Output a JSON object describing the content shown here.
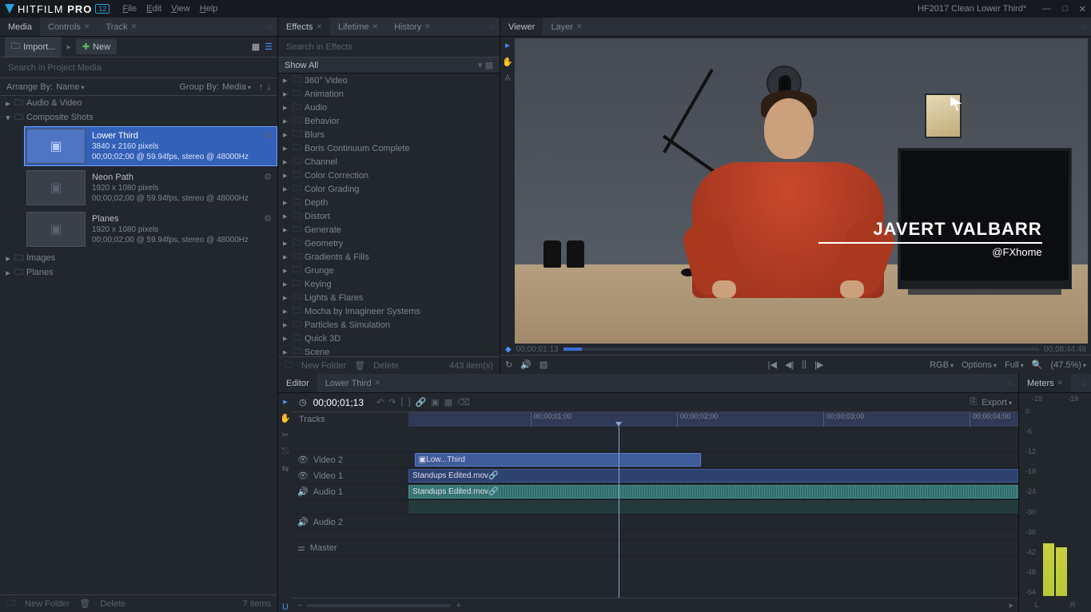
{
  "titlebar": {
    "app_name_light": "HITFILM",
    "app_name_bold": "PRO",
    "version": "12",
    "menu": [
      "File",
      "Edit",
      "View",
      "Help"
    ],
    "project_name": "HF2017 Clean Lower Third*"
  },
  "media_panel": {
    "tabs": [
      {
        "label": "Media",
        "active": true
      },
      {
        "label": "Controls",
        "close": true
      },
      {
        "label": "Track",
        "close": true
      }
    ],
    "import_label": "Import...",
    "new_label": "New",
    "search_placeholder": "Search in Project Media",
    "arrange_label": "Arrange By:",
    "arrange_value": "Name",
    "group_label": "Group By:",
    "group_value": "Media",
    "top_folders": [
      {
        "name": "Audio & Video",
        "open": false
      },
      {
        "name": "Composite Shots",
        "open": true
      }
    ],
    "comps": [
      {
        "name": "Lower Third",
        "dims": "3840 x 2160 pixels",
        "info": "00;00;02;00 @ 59.94fps, stereo @ 48000Hz",
        "selected": true
      },
      {
        "name": "Neon Path",
        "dims": "1920 x 1080 pixels",
        "info": "00;00;02;00 @ 59.94fps, stereo @ 48000Hz",
        "selected": false
      },
      {
        "name": "Planes",
        "dims": "1920 x 1080 pixels",
        "info": "00;00;02;00 @ 59.94fps, stereo @ 48000Hz",
        "selected": false
      }
    ],
    "bottom_folders": [
      "Images",
      "Planes"
    ],
    "footer_new": "New Folder",
    "footer_del": "Delete",
    "footer_count": "7 items"
  },
  "effects_panel": {
    "tabs": [
      {
        "label": "Effects",
        "active": true,
        "close": true
      },
      {
        "label": "Lifetime",
        "close": true
      },
      {
        "label": "History",
        "close": true
      }
    ],
    "search_placeholder": "Search in Effects",
    "show_all": "Show All",
    "folders": [
      "360° Video",
      "Animation",
      "Audio",
      "Behavior",
      "Blurs",
      "Boris Continuum Complete",
      "Channel",
      "Color Correction",
      "Color Grading",
      "Depth",
      "Distort",
      "Generate",
      "Geometry",
      "Gradients & Fills",
      "Grunge",
      "Keying",
      "Lights & Flares",
      "Mocha by Imagineer Systems",
      "Particles & Simulation",
      "Quick 3D",
      "Scene"
    ],
    "footer_new": "New Folder",
    "footer_del": "Delete",
    "footer_count": "443 item(s)"
  },
  "viewer_panel": {
    "tabs": [
      {
        "label": "Viewer",
        "active": true
      },
      {
        "label": "Layer",
        "close": true
      }
    ],
    "lower_third_name": "JAVERT VALBARR",
    "lower_third_handle": "@FXhome",
    "tc_left": "00;00;01;13",
    "tc_right": "00;08;44;48",
    "transport": {
      "rgb": "RGB",
      "options": "Options",
      "full": "Full",
      "zoom": "(47.5%)"
    }
  },
  "editor_panel": {
    "tabs": [
      {
        "label": "Editor",
        "active": true
      },
      {
        "label": "Lower Third",
        "close": true
      }
    ],
    "tc": "00;00;01;13",
    "tracks_label": "Tracks",
    "export": "Export",
    "ruler": [
      "00;00;01;00",
      "00;00;02;00",
      "00;00;03;00",
      "00;00;04;00"
    ],
    "lanes": [
      {
        "name": "Video 2",
        "icon": "eye"
      },
      {
        "name": "Video 1",
        "icon": "eye"
      },
      {
        "name": "Audio 1",
        "icon": "speaker"
      },
      {
        "name": "Audio 2",
        "icon": "speaker"
      },
      {
        "name": "Master",
        "icon": "sliders"
      }
    ],
    "clips": {
      "video2": "Low...Third",
      "video1": "Standups Edited.mov",
      "audio1": "Standups Edited.mov"
    }
  },
  "meters_panel": {
    "tab": "Meters",
    "scale": [
      "-18",
      "-19",
      "0",
      "-6",
      "-12",
      "-18",
      "-24",
      "-30",
      "-36",
      "-42",
      "-48",
      "-54"
    ],
    "labels": {
      "l": "L",
      "r": "R"
    }
  }
}
